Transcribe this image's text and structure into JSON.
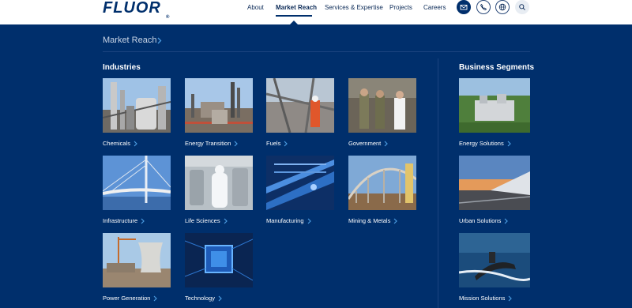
{
  "brand": {
    "logo_text": "FLUOR",
    "registered": "®"
  },
  "nav": {
    "items": [
      {
        "label": "About"
      },
      {
        "label": "Market Reach"
      },
      {
        "label": "Services & Expertise"
      },
      {
        "label": "Projects"
      },
      {
        "label": "Careers"
      }
    ],
    "active": "Market Reach",
    "icons": [
      "mail-icon",
      "phone-icon",
      "globe-icon",
      "search-icon"
    ]
  },
  "breadcrumb": {
    "label": "Market Reach"
  },
  "industries": {
    "title": "Industries",
    "tiles": [
      {
        "label": "Chemicals"
      },
      {
        "label": "Energy Transition"
      },
      {
        "label": "Fuels"
      },
      {
        "label": "Government"
      },
      {
        "label": "Infrastructure"
      },
      {
        "label": "Life Sciences"
      },
      {
        "label": "Manufacturing"
      },
      {
        "label": "Mining & Metals"
      },
      {
        "label": "Power Generation"
      },
      {
        "label": "Technology"
      }
    ]
  },
  "segments": {
    "title": "Business Segments",
    "tiles": [
      {
        "label": "Energy Solutions"
      },
      {
        "label": "Urban Solutions"
      },
      {
        "label": "Mission Solutions"
      }
    ]
  },
  "colors": {
    "navy": "#002f6c",
    "white": "#ffffff",
    "accent": "#4a9be0"
  }
}
